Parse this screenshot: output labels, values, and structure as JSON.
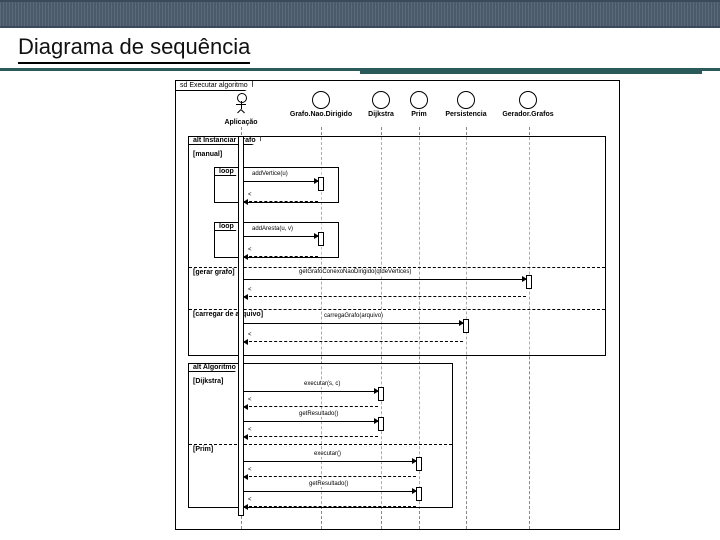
{
  "slide": {
    "title": "Diagrama de sequência"
  },
  "diagram": {
    "frame_label": "sd  Executar algoritmo",
    "participants": {
      "actor": "Aplicação",
      "p1": "Grafo.Nao.Dirigido",
      "p2": "Dijkstra",
      "p3": "Prim",
      "p4": "Persistencia",
      "p5": "Gerador.Grafos"
    },
    "fragments": {
      "alt1": {
        "label": "alt Instanciar grafo",
        "guard_manual": "[manual]",
        "guard_gerar": "[gerar grafo]",
        "guard_carregar": "[carregar de arquivo]"
      },
      "loop1": {
        "label": "loop"
      },
      "loop2": {
        "label": "loop"
      },
      "alt2": {
        "label": "alt Algoritmo",
        "guard_dij": "[Dijkstra]",
        "guard_prim": "[Prim]"
      }
    },
    "messages": {
      "addVertice": "addVertice(u)",
      "addAresta": "addAresta(u, v)",
      "getGrafo": "getGrafoConexoNaoDirigido(qtdeVertices)",
      "carrega": "carregaGrafo(arquivo)",
      "exec_sc": "executar(s, c)",
      "getRes1": "getResultado()",
      "exec": "executar()",
      "getRes2": "getResultado()"
    }
  }
}
